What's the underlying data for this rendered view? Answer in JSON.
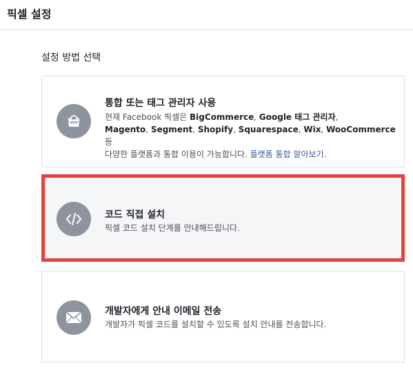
{
  "header": {
    "title": "픽셀 설정"
  },
  "section": {
    "title": "설정 방법 선택"
  },
  "options": [
    {
      "title": "통합 또는 태그 관리자 사용",
      "desc_prefix": "현재 Facebook 픽셀은 ",
      "partners_1": [
        {
          "name": "BigCommerce",
          "sep": ", "
        },
        {
          "name": "Google 태그 관리자",
          "sep": ","
        }
      ],
      "partners_2": [
        {
          "name": "Magento",
          "sep": ", "
        },
        {
          "name": "Segment",
          "sep": ", "
        },
        {
          "name": "Shopify",
          "sep": ", "
        },
        {
          "name": "Squarespace",
          "sep": ", "
        },
        {
          "name": "Wix",
          "sep": ", "
        },
        {
          "name": "WooCommerce",
          "sep": " 등"
        }
      ],
      "desc_suffix": "다양한 플랫폼과 통합 이용이 가능합니다. ",
      "link": "플랫폼 통합 알아보기",
      "link_end": ".",
      "icon": "shopping-bag-icon",
      "selected": false
    },
    {
      "title": "코드 직접 설치",
      "desc": "픽셀 코드 설치 단계를 안내해드립니다.",
      "icon": "code-icon",
      "selected": true
    },
    {
      "title": "개발자에게 안내 이메일 전송",
      "desc": "개발자가 픽셀 코드를 설치할 수 있도록 설치 안내를 전송합니다.",
      "icon": "envelope-icon",
      "selected": false
    }
  ],
  "colors": {
    "selected_border": "#e8403b",
    "icon_bg": "#8d949e",
    "link": "#365899"
  }
}
